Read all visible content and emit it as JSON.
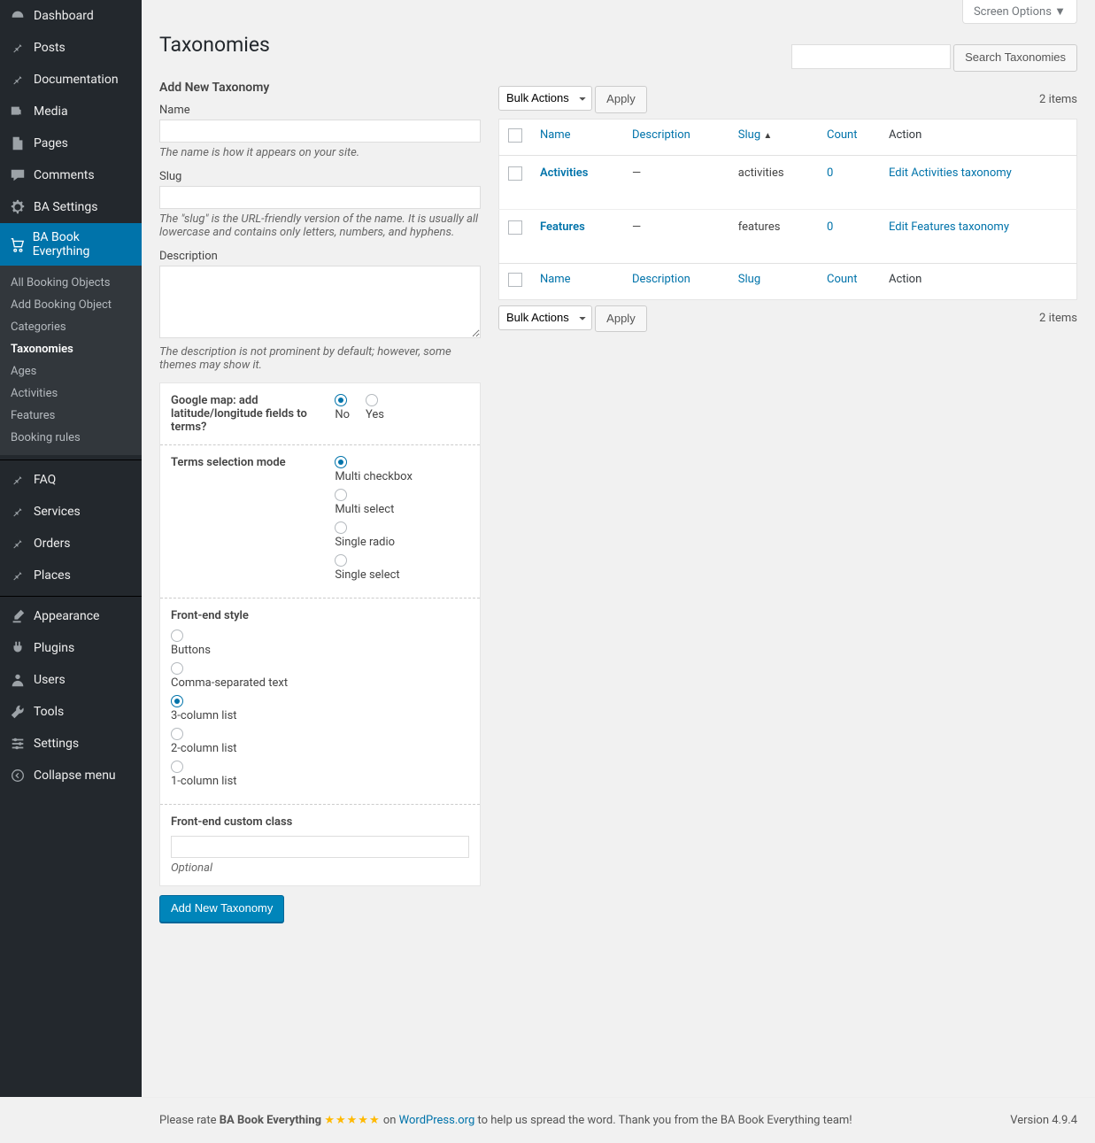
{
  "screen_options": "Screen Options ▼",
  "page_title": "Taxonomies",
  "sidebar": {
    "items": [
      {
        "label": "Dashboard",
        "icon": "dashboard"
      },
      {
        "label": "Posts",
        "icon": "pin"
      },
      {
        "label": "Documentation",
        "icon": "pin"
      },
      {
        "label": "Media",
        "icon": "media"
      },
      {
        "label": "Pages",
        "icon": "page"
      },
      {
        "label": "Comments",
        "icon": "comment"
      },
      {
        "label": "BA Settings",
        "icon": "gear"
      },
      {
        "label": "BA Book Everything",
        "icon": "cart",
        "active": true
      },
      {
        "label": "FAQ",
        "icon": "pin"
      },
      {
        "label": "Services",
        "icon": "pin"
      },
      {
        "label": "Orders",
        "icon": "pin"
      },
      {
        "label": "Places",
        "icon": "pin"
      },
      {
        "label": "Appearance",
        "icon": "brush"
      },
      {
        "label": "Plugins",
        "icon": "plug"
      },
      {
        "label": "Users",
        "icon": "user"
      },
      {
        "label": "Tools",
        "icon": "wrench"
      },
      {
        "label": "Settings",
        "icon": "sliders"
      },
      {
        "label": "Collapse menu",
        "icon": "collapse"
      }
    ],
    "submenu": [
      {
        "label": "All Booking Objects"
      },
      {
        "label": "Add Booking Object"
      },
      {
        "label": "Categories"
      },
      {
        "label": "Taxonomies",
        "active": true
      },
      {
        "label": "Ages"
      },
      {
        "label": "Activities"
      },
      {
        "label": "Features"
      },
      {
        "label": "Booking rules"
      }
    ]
  },
  "form": {
    "heading": "Add New Taxonomy",
    "name_label": "Name",
    "name_help": "The name is how it appears on your site.",
    "slug_label": "Slug",
    "slug_help": "The \"slug\" is the URL-friendly version of the name. It is usually all lowercase and contains only letters, numbers, and hyphens.",
    "desc_label": "Description",
    "desc_help": "The description is not prominent by default; however, some themes may show it.",
    "gmap": {
      "label": "Google map: add latitude/longitude fields to terms?",
      "options": [
        "No",
        "Yes"
      ],
      "selected": 0
    },
    "selection_mode": {
      "label": "Terms selection mode",
      "options": [
        "Multi checkbox",
        "Multi select",
        "Single radio",
        "Single select"
      ],
      "selected": 0
    },
    "front_style": {
      "label": "Front-end style",
      "options": [
        "Buttons",
        "Comma-separated text",
        "3-column list",
        "2-column list",
        "1-column list"
      ],
      "selected": 2
    },
    "custom_class": {
      "label": "Front-end custom class",
      "help": "Optional"
    },
    "submit": "Add New Taxonomy"
  },
  "list": {
    "search_button": "Search Taxonomies",
    "bulk_label": "Bulk Actions",
    "apply": "Apply",
    "count_text": "2 items",
    "columns": {
      "name": "Name",
      "description": "Description",
      "slug": "Slug",
      "count": "Count",
      "action": "Action"
    },
    "sorted_col": "slug",
    "rows": [
      {
        "name": "Activities",
        "description": "—",
        "slug": "activities",
        "count": "0",
        "action": "Edit Activities taxonomy"
      },
      {
        "name": "Features",
        "description": "—",
        "slug": "features",
        "count": "0",
        "action": "Edit Features taxonomy"
      }
    ]
  },
  "footer": {
    "rate_pre": "Please rate ",
    "product": "BA Book Everything",
    "stars": "★★★★★",
    "on": " on ",
    "wp": "WordPress.org",
    "post": " to help us spread the word. Thank you from the BA Book Everything team!",
    "version": "Version 4.9.4"
  }
}
